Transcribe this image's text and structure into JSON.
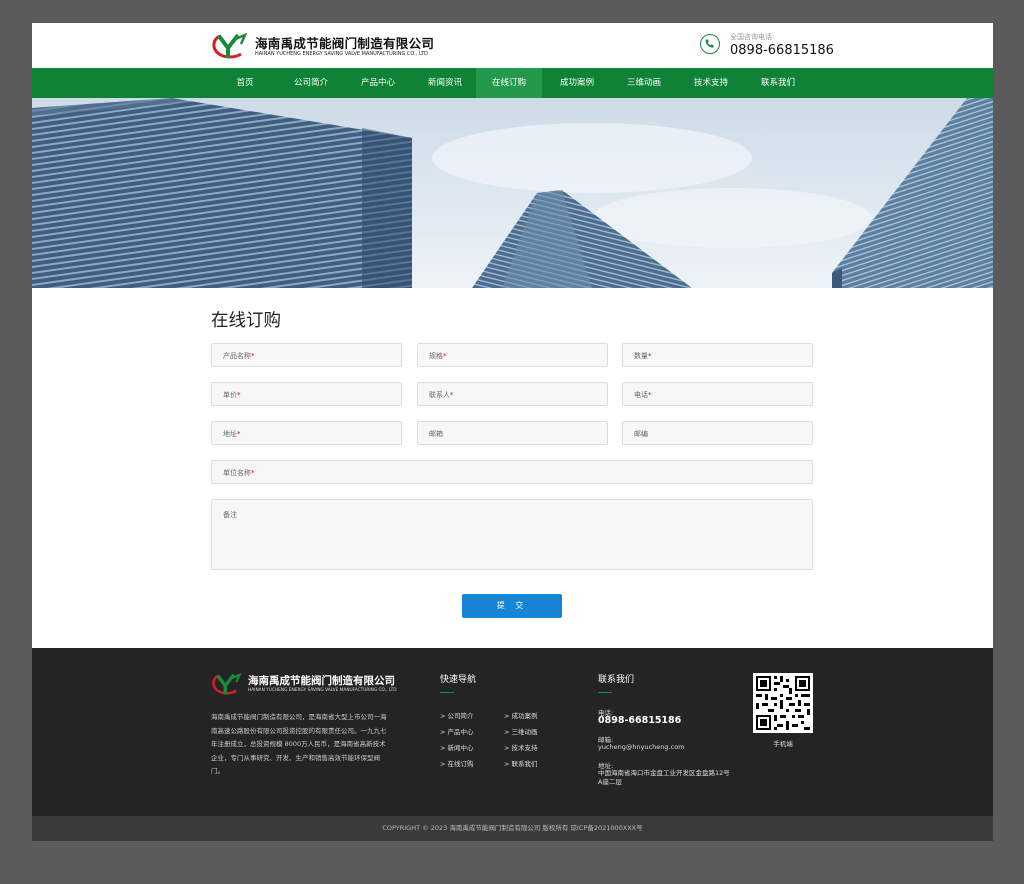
{
  "header": {
    "company_cn": "海南禹成节能阀门制造有限公司",
    "company_en": "HAINAN YUCHENG ENERGY SAVING VALVE MANUFACTURING CO., LTD",
    "hotline_label": "全国咨询电话:",
    "hotline": "0898-66815186"
  },
  "nav": {
    "items": [
      {
        "label": "首页"
      },
      {
        "label": "公司简介"
      },
      {
        "label": "产品中心"
      },
      {
        "label": "新闻资讯"
      },
      {
        "label": "在线订购"
      },
      {
        "label": "成功案例"
      },
      {
        "label": "三维动画"
      },
      {
        "label": "技术支持"
      },
      {
        "label": "联系我们"
      }
    ],
    "active": "在线订购"
  },
  "form": {
    "title": "在线订购",
    "fields": [
      {
        "label": "产品名称",
        "required": true
      },
      {
        "label": "规格",
        "required": true
      },
      {
        "label": "数量",
        "required": true
      },
      {
        "label": "单价",
        "required": true
      },
      {
        "label": "联系人",
        "required": true
      },
      {
        "label": "电话",
        "required": true
      },
      {
        "label": "地址",
        "required": true
      },
      {
        "label": "邮箱",
        "required": false
      },
      {
        "label": "邮编",
        "required": false
      },
      {
        "label": "单位名称",
        "required": true
      },
      {
        "label": "备注",
        "required": false
      }
    ],
    "required_mark": "*",
    "submit_label": "提 交"
  },
  "footer": {
    "company_cn": "海南禹成节能阀门制造有限公司",
    "company_en": "HAINAN YUCHENG ENERGY SAVING VALVE MANUFACTURING CO., LTD",
    "intro": "海南禹成节能阀门制造有限公司，是海南省大型上市公司一海南高速公路股份有限公司投资控股的有限责任公司。一九九七年注册成立，总投资规模 8000万人民币，是海南省高新技术企业，专门从事研究、开发、生产和销售高效节能环保型阀门。",
    "quick_nav_title": "快速导航",
    "quick_links": [
      {
        "label": "> 公司简介"
      },
      {
        "label": "> 成功案例"
      },
      {
        "label": "> 产品中心"
      },
      {
        "label": "> 三维动画"
      },
      {
        "label": "> 新闻中心"
      },
      {
        "label": "> 技术支持"
      },
      {
        "label": "> 在线订购"
      },
      {
        "label": "> 联系我们"
      }
    ],
    "contact_title": "联系我们",
    "tel_label": "电话:",
    "tel": "0898-66815186",
    "email_label": "邮箱:",
    "email": "yucheng@hnyucheng.com",
    "addr_label": "地址:",
    "addr": "中国海南省海口市金盘工业开发区金盘路12号A座二层",
    "qr_label": "手机端",
    "copyright": "COPYRIGHT © 2023  海南禹成节能阀门制造有限公司  版权所有  琼ICP备2021000XXX号"
  },
  "colors": {
    "brand_green": "#108236",
    "nav_active": "#22994b",
    "button_blue": "#1785d6",
    "footer_bg": "#242424",
    "required_red": "#d0021b"
  }
}
